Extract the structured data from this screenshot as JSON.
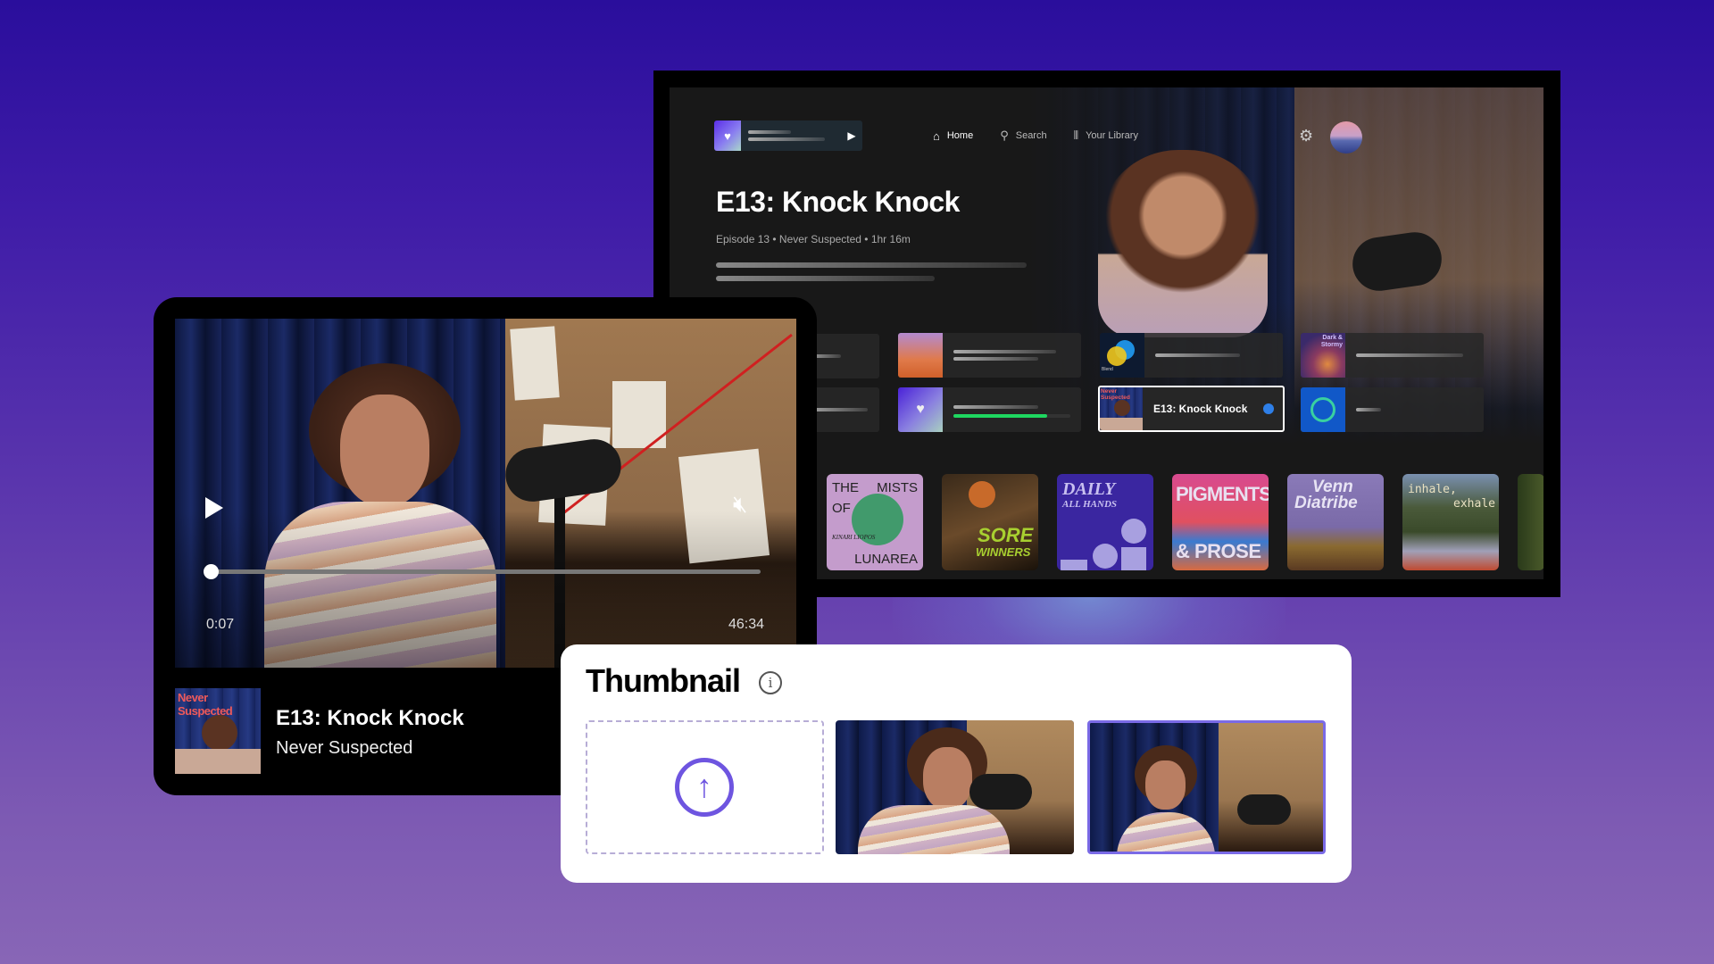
{
  "tv": {
    "mini_player": {
      "art_icon": "heart-icon",
      "play_icon": "play-icon"
    },
    "nav": [
      {
        "label": "Home",
        "icon": "home-icon",
        "active": true
      },
      {
        "label": "Search",
        "icon": "search-icon",
        "active": false
      },
      {
        "label": "Your Library",
        "icon": "library-icon",
        "active": false
      }
    ],
    "settings_icon": "gear-icon",
    "hero": {
      "title": "E13: Knock Knock",
      "meta": "Episode 13 • Never Suspected • 1hr 16m"
    },
    "grid": {
      "selected_card": {
        "label": "E13: Knock Knock",
        "art_text": "Never Suspected"
      },
      "blend_card_art_text": "Blend",
      "dark_stormy_card_art_text": "Dark & Stormy",
      "liked_progress": 0.8
    },
    "shelf": [
      {
        "line1": "THE",
        "line1b": "MISTS",
        "line2": "OF",
        "line3": "KINARI LIOPOS",
        "line4": "LUNAREA"
      },
      {
        "line1": "SORE",
        "line2": "WINNERS"
      },
      {
        "line1": "DAILY",
        "line2": "ALL HANDS"
      },
      {
        "line1": "PIGMENTS",
        "line2": "& PROSE"
      },
      {
        "line1": "Venn",
        "line2": "Diatribe"
      },
      {
        "line1": "inhale,",
        "line2": "exhale"
      }
    ]
  },
  "player": {
    "current_time": "0:07",
    "total_time": "46:34",
    "progress": 0.0025,
    "muted": true,
    "now_playing": {
      "title": "E13: Knock Knock",
      "show": "Never Suspected",
      "art_text": "Never Suspected"
    }
  },
  "thumbnail_panel": {
    "title": "Thumbnail",
    "info_icon": "info-icon",
    "upload_icon": "upload-arrow-icon",
    "selected_option": 2
  },
  "colors": {
    "accent_purple": "#6e55e0",
    "selected_border": "#7a6ae6",
    "progress_green": "#1ed760",
    "focus_dot": "#2e7fe8",
    "cover_title_red": "#ef5a5a"
  }
}
